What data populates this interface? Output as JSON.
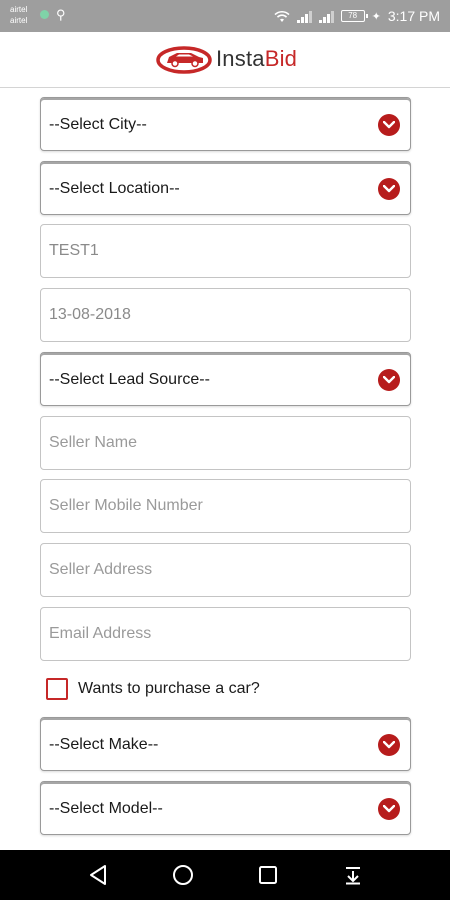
{
  "status_bar": {
    "carrier_1": "airtel",
    "carrier_2": "airtel",
    "battery": "78",
    "time": "3:17 PM"
  },
  "header": {
    "logo_part_1": "Insta",
    "logo_part_2": "Bid",
    "brand_color": "#c62828"
  },
  "form": {
    "city_select": {
      "value": "--Select City--"
    },
    "location_select": {
      "value": "--Select Location--"
    },
    "test_field": {
      "value": "TEST1"
    },
    "date_field": {
      "value": "13-08-2018"
    },
    "lead_source_select": {
      "value": "--Select Lead Source--"
    },
    "seller_name": {
      "placeholder": "Seller Name"
    },
    "seller_mobile": {
      "placeholder": "Seller Mobile Number"
    },
    "seller_address": {
      "placeholder": "Seller Address"
    },
    "email_address": {
      "placeholder": "Email Address"
    },
    "purchase_checkbox": {
      "label": "Wants to purchase a car?",
      "checked": false
    },
    "make_select": {
      "value": "--Select Make--"
    },
    "model_select": {
      "value": "--Select Model--"
    }
  },
  "icons": {
    "dropdown": "chevron-down-icon",
    "nav_back": "back-icon",
    "nav_home": "home-icon",
    "nav_recents": "recents-icon",
    "nav_notifications": "notification-pull-icon"
  }
}
